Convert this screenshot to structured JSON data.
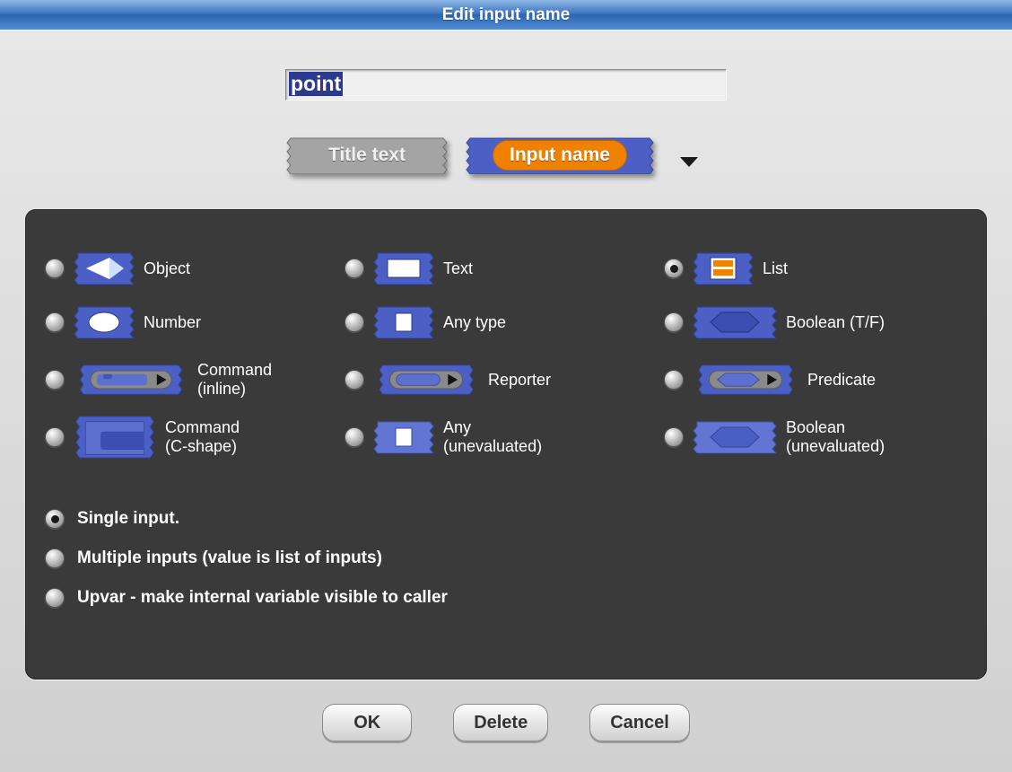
{
  "title": "Edit input name",
  "input_name": "point",
  "tabs": {
    "title_text": "Title text",
    "input_name": "Input name"
  },
  "types": {
    "object": "Object",
    "text": "Text",
    "list": "List",
    "number": "Number",
    "anytype": "Any type",
    "boolean": "Boolean (T/F)",
    "cmd_inline": "Command\n(inline)",
    "reporter": "Reporter",
    "predicate": "Predicate",
    "cmd_cshape": "Command\n(C-shape)",
    "any_uneval": "Any\n(unevaluated)",
    "bool_uneval": "Boolean\n(unevaluated)",
    "selected": "list"
  },
  "arity": {
    "single": "Single input.",
    "multiple": "Multiple inputs (value is list of inputs)",
    "upvar": "Upvar - make internal variable visible to caller",
    "selected": "single"
  },
  "buttons": {
    "ok": "OK",
    "delete": "Delete",
    "cancel": "Cancel"
  },
  "colors": {
    "accent": "#4b5fc4",
    "orange": "#ee8100",
    "panel": "#3a3a3a"
  }
}
